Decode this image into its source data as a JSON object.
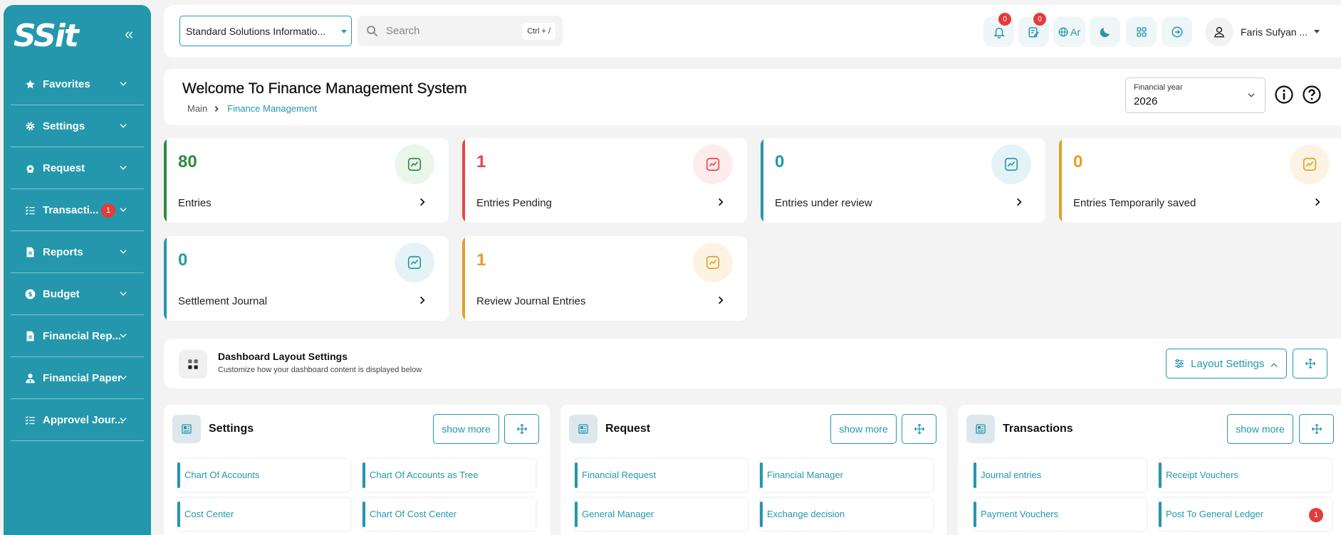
{
  "sidebar": {
    "logo": "SSit",
    "collapse_glyph": "«",
    "items": [
      {
        "label": "Favorites",
        "icon": "star-icon"
      },
      {
        "label": "Settings",
        "icon": "gear-icon"
      },
      {
        "label": "Request",
        "icon": "money-bag-icon"
      },
      {
        "label": "Transacti...",
        "icon": "list-check-icon",
        "badge": "1"
      },
      {
        "label": "Reports",
        "icon": "document-icon"
      },
      {
        "label": "Budget",
        "icon": "dollar-circle-icon"
      },
      {
        "label": "Financial Rep...",
        "icon": "document-icon"
      },
      {
        "label": "Financial Paper",
        "icon": "user-tie-icon"
      },
      {
        "label": "Approvel Jour...",
        "icon": "list-check-icon"
      }
    ]
  },
  "topbar": {
    "company": "Standard Solutions Informatio...",
    "search_placeholder": "Search",
    "search_shortcut": "Ctrl + /",
    "notifications_count": "0",
    "tasks_count": "0",
    "language": "Ar",
    "user_name": "Faris Sufyan ..."
  },
  "welcome": {
    "title": "Welcome To Finance Management System",
    "breadcrumb_main": "Main",
    "breadcrumb_sep": "›",
    "breadcrumb_current": "Finance Management",
    "financial_year_label": "Financial year",
    "financial_year_value": "2026"
  },
  "stats": [
    {
      "value": "80",
      "label": "Entries",
      "color": "#2e8b3d",
      "bg": "#eaf6ea"
    },
    {
      "value": "1",
      "label": "Entries Pending",
      "color": "#e84545",
      "bg": "#fdecec"
    },
    {
      "value": "0",
      "label": "Entries under review",
      "color": "#2497ad",
      "bg": "#e6f3f6"
    },
    {
      "value": "0",
      "label": "Entries Temporarily saved",
      "color": "#e0a125",
      "bg": "#fdf3e3"
    },
    {
      "value": "0",
      "label": "Settlement Journal",
      "color": "#2497ad",
      "bg": "#e6f3f6"
    },
    {
      "value": "1",
      "label": "Review Journal Entries",
      "color": "#e0a125",
      "bg": "#fdf3e3"
    }
  ],
  "layout_settings": {
    "title": "Dashboard Layout Settings",
    "subtitle": "Customize how your dashboard content is displayed below",
    "button": "Layout Settings"
  },
  "sections": [
    {
      "title": "Settings",
      "show_more": "show more",
      "links": [
        "Chart Of Accounts",
        "Chart Of Accounts as Tree",
        "Cost Center",
        "Chart Of Cost Center"
      ]
    },
    {
      "title": "Request",
      "show_more": "show more",
      "links": [
        "Financial Request",
        "Financial Manager",
        "General Manager",
        "Exchange decision"
      ]
    },
    {
      "title": "Transactions",
      "show_more": "show more",
      "links": [
        "Journal entries",
        "Receipt Vouchers",
        "Payment Vouchers",
        "Post To General Ledger"
      ],
      "link_badge": "1"
    }
  ],
  "colors": {
    "accent": "#2497ad",
    "badge": "#e43b3b"
  }
}
